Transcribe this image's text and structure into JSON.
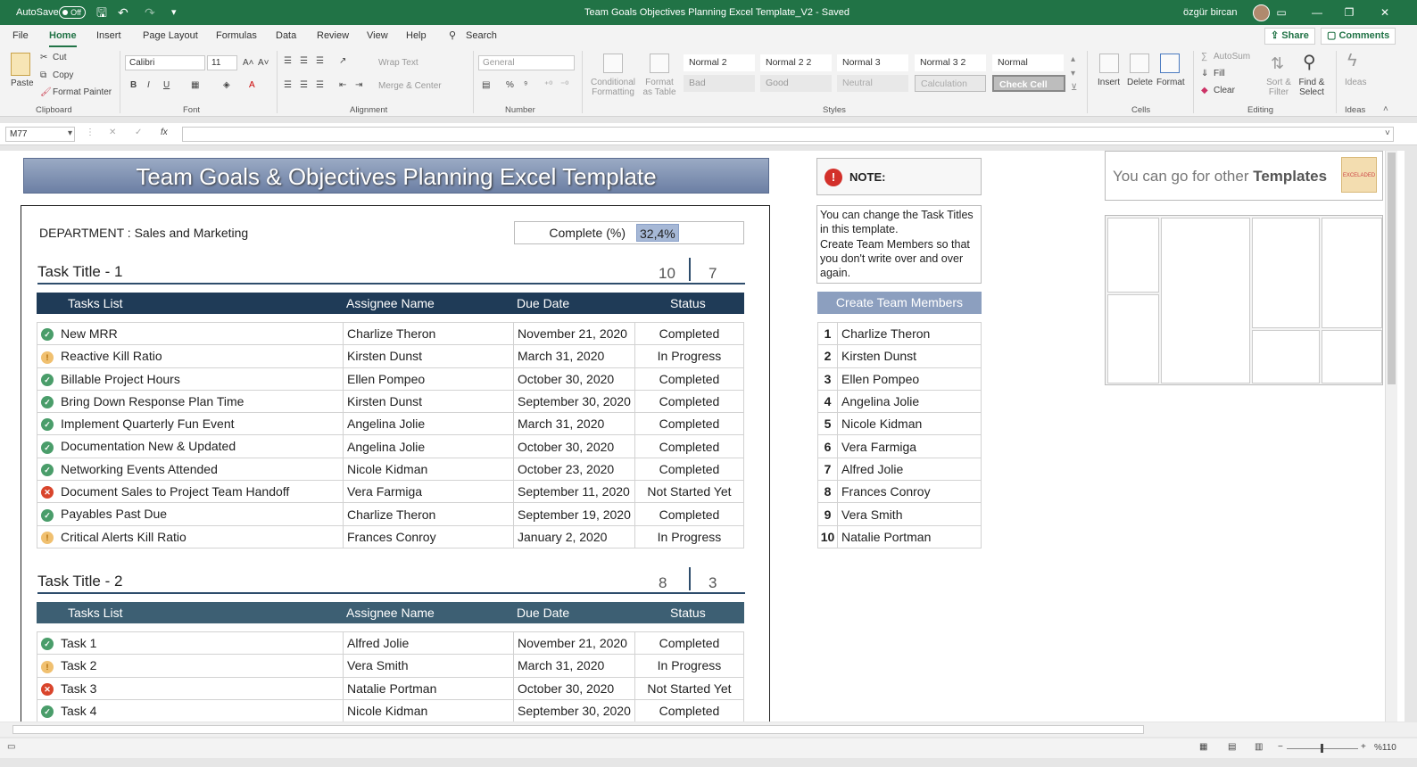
{
  "titlebar": {
    "autosave_label": "AutoSave",
    "autosave_state": "Off",
    "doc_title": "Team Goals Objectives Planning Excel Template_V2  -  Saved",
    "user": "özgür bircan"
  },
  "ribbon_tabs": [
    "File",
    "Home",
    "Insert",
    "Page Layout",
    "Formulas",
    "Data",
    "Review",
    "View",
    "Help"
  ],
  "search_label": "Search",
  "share_label": "Share",
  "comments_label": "Comments",
  "ribbon": {
    "paste": "Paste",
    "cut": "Cut",
    "copy": "Copy",
    "format_painter": "Format Painter",
    "font_name": "Calibri",
    "font_size": "11",
    "wrap_text": "Wrap Text",
    "merge_center": "Merge & Center",
    "number_format": "General",
    "conditional_formatting": "Conditional Formatting",
    "format_as_table": "Format as Table",
    "styles": [
      "Normal 2",
      "Normal 2 2",
      "Normal 3",
      "Normal 3 2",
      "Normal",
      "Bad",
      "Good",
      "Neutral",
      "Calculation",
      "Check Cell"
    ],
    "insert": "Insert",
    "delete": "Delete",
    "format": "Format",
    "autosum": "AutoSum",
    "fill": "Fill",
    "clear": "Clear",
    "sort_filter": "Sort & Filter",
    "find_select": "Find & Select",
    "ideas": "Ideas",
    "groups": [
      "Clipboard",
      "Font",
      "Alignment",
      "Number",
      "Styles",
      "Cells",
      "Editing",
      "Ideas"
    ]
  },
  "formula_bar": {
    "name_box": "M77",
    "fx": "fx",
    "value": ""
  },
  "sheet": {
    "header": "Team Goals & Objectives Planning Excel Template",
    "department": "DEPARTMENT : Sales and Marketing",
    "complete_label": "Complete (%)",
    "complete_value": "32,4%",
    "columns": [
      "Tasks List",
      "Assignee Name",
      "Due Date",
      "Status"
    ],
    "sections": [
      {
        "title": "Task Title - 1",
        "count_a": "10",
        "count_b": "7",
        "rows": [
          {
            "icon": "check",
            "task": "New MRR",
            "assignee": "Charlize Theron",
            "due": "November 21, 2020",
            "status": "Completed"
          },
          {
            "icon": "progress",
            "task": "Reactive Kill Ratio",
            "assignee": "Kirsten Dunst",
            "due": "March 31, 2020",
            "status": "In Progress"
          },
          {
            "icon": "check",
            "task": "Billable Project Hours",
            "assignee": "Ellen Pompeo",
            "due": "October 30, 2020",
            "status": "Completed"
          },
          {
            "icon": "check",
            "task": "Bring Down Response Plan Time",
            "assignee": "Kirsten Dunst",
            "due": "September 30, 2020",
            "status": "Completed"
          },
          {
            "icon": "check",
            "task": "Implement Quarterly Fun Event",
            "assignee": "Angelina Jolie",
            "due": "March 31, 2020",
            "status": "Completed"
          },
          {
            "icon": "check",
            "task": "Documentation New & Updated",
            "assignee": "Angelina Jolie",
            "due": "October 30, 2020",
            "status": "Completed"
          },
          {
            "icon": "check",
            "task": "Networking Events Attended",
            "assignee": "Nicole Kidman",
            "due": "October 23, 2020",
            "status": "Completed"
          },
          {
            "icon": "cross",
            "task": "Document Sales to Project Team Handoff",
            "assignee": "Vera Farmiga",
            "due": "September 11, 2020",
            "status": "Not Started Yet"
          },
          {
            "icon": "check",
            "task": "Payables Past Due",
            "assignee": "Charlize Theron",
            "due": "September 19, 2020",
            "status": "Completed"
          },
          {
            "icon": "progress",
            "task": "Critical Alerts Kill Ratio",
            "assignee": "Frances Conroy",
            "due": "January 2, 2020",
            "status": "In Progress"
          }
        ]
      },
      {
        "title": "Task Title - 2",
        "count_a": "8",
        "count_b": "3",
        "rows": [
          {
            "icon": "check",
            "task": "Task 1",
            "assignee": "Alfred Jolie",
            "due": "November 21, 2020",
            "status": "Completed"
          },
          {
            "icon": "progress",
            "task": "Task 2",
            "assignee": "Vera Smith",
            "due": "March 31, 2020",
            "status": "In Progress"
          },
          {
            "icon": "cross",
            "task": "Task 3",
            "assignee": "Natalie Portman",
            "due": "October 30, 2020",
            "status": "Not Started Yet"
          },
          {
            "icon": "check",
            "task": "Task 4",
            "assignee": "Nicole Kidman",
            "due": "September 30, 2020",
            "status": "Completed"
          }
        ]
      }
    ],
    "note_title": "NOTE:",
    "note_lines": [
      "You can change the Task Titles",
      "in this template.",
      "Create Team Members so that",
      "you don't write over and over",
      "again."
    ],
    "create_members": "Create Team Members",
    "members": [
      "Charlize Theron",
      "Kirsten Dunst",
      "Ellen Pompeo",
      "Angelina Jolie",
      "Nicole Kidman",
      "Vera Farmiga",
      "Alfred Jolie",
      "Frances Conroy",
      "Vera Smith",
      "Natalie Portman"
    ],
    "other_templates_prefix": "You can go for other ",
    "other_templates_bold": "Templates",
    "logo_text": "EXCELADED"
  },
  "status_bar": {
    "zoom": "%110"
  },
  "colors": {
    "excel_green": "#217346",
    "header_dark": "#1f3b57",
    "header_teal": "#3d5f73",
    "accent_blue": "#8c9fbf"
  }
}
